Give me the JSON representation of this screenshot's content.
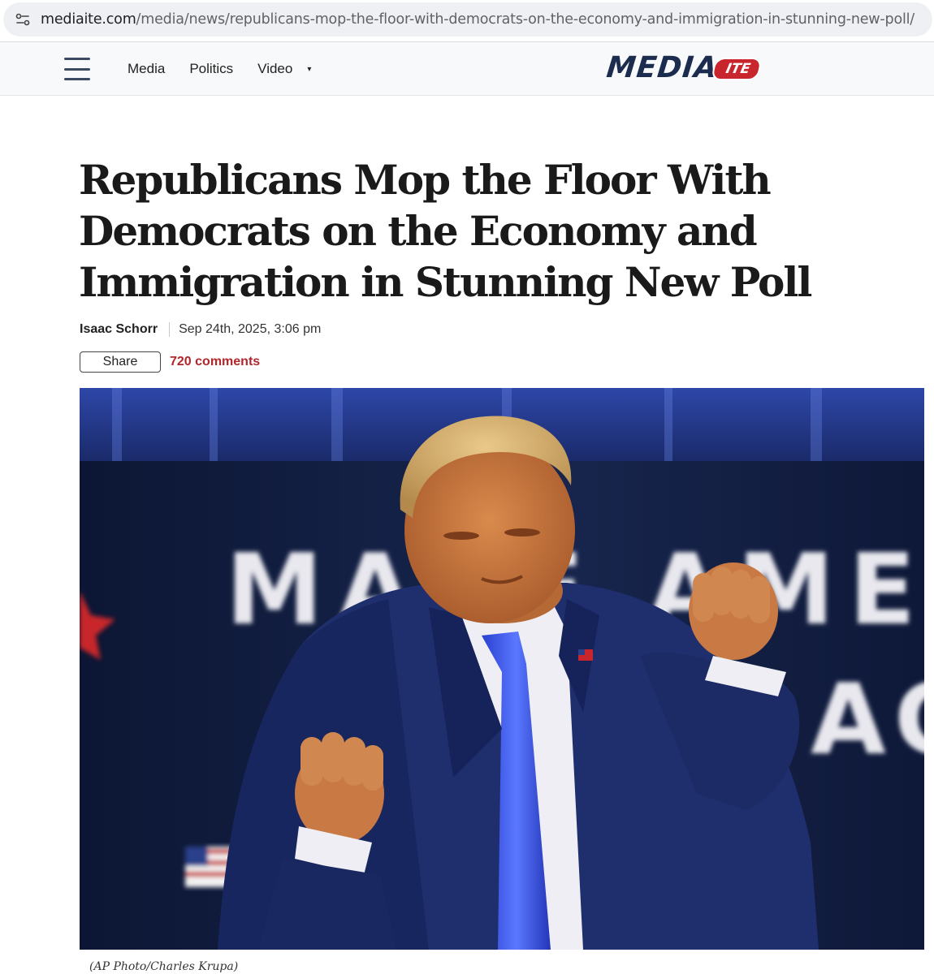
{
  "browser": {
    "url_domain": "mediaite.com",
    "url_path": "/media/news/republicans-mop-the-floor-with-democrats-on-the-economy-and-immigration-in-stunning-new-poll/",
    "site_settings_icon": "tune-icon"
  },
  "header": {
    "menu_icon": "hamburger-menu-icon",
    "nav": [
      "Media",
      "Politics",
      "Video"
    ],
    "nav_caret": "▾",
    "logo_main": "MEDIA",
    "logo_badge": "ITE",
    "logo_colors": {
      "main": "#1c2c4f",
      "badge": "#c8252c"
    }
  },
  "article": {
    "headline": "Republicans Mop the Floor With Democrats on the Economy and Immigration in Stunning New Poll",
    "author": "Isaac Schorr",
    "date": "Sep 24th, 2025, 3:06 pm",
    "share_label": "Share",
    "comments_label": "720 comments",
    "accent_color": "#b1262b"
  },
  "hero": {
    "backdrop_text_row1": "MAKE AME",
    "backdrop_text_row2": "AG",
    "caption": "(AP Photo/Charles Krupa)"
  }
}
